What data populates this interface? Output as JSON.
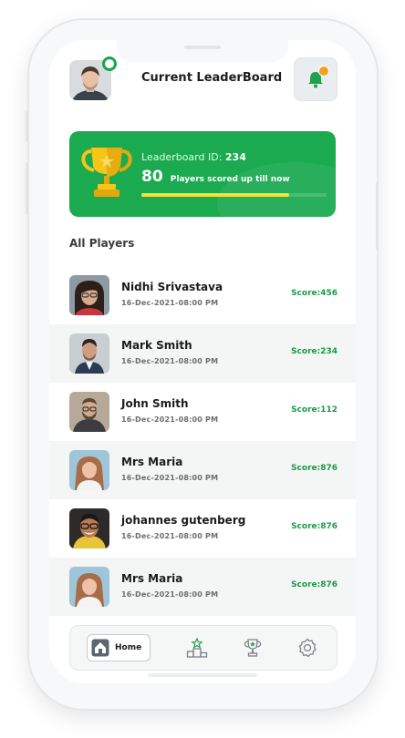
{
  "header": {
    "title": "Current LeaderBoard"
  },
  "leaderboard": {
    "id_label": "Leaderboard ID:",
    "id_value": "234",
    "count": "80",
    "count_text": "Players scored up till now",
    "progress_fraction": 0.8
  },
  "section_title": "All Players",
  "players": [
    {
      "name": "Nidhi Srivastava",
      "date": "16-Dec-2021-08:00 PM",
      "score": "Score:456"
    },
    {
      "name": "Mark Smith",
      "date": "16-Dec-2021-08:00 PM",
      "score": "Score:234"
    },
    {
      "name": "John Smith",
      "date": "16-Dec-2021-08:00 PM",
      "score": "Score:112"
    },
    {
      "name": "Mrs Maria",
      "date": "16-Dec-2021-08:00 PM",
      "score": "Score:876"
    },
    {
      "name": "johannes gutenberg",
      "date": "16-Dec-2021-08:00 PM",
      "score": "Score:876"
    },
    {
      "name": "Mrs Maria",
      "date": "16-Dec-2021-08:00 PM",
      "score": "Score:876"
    }
  ],
  "nav": {
    "home_label": "Home",
    "icons": [
      "home-icon",
      "podium-icon",
      "trophy-icon",
      "settings-icon"
    ]
  },
  "colors": {
    "accent": "#1caa51",
    "score": "#1a9a46",
    "notification": "#f4a21c",
    "progress": "#f7e23a"
  }
}
